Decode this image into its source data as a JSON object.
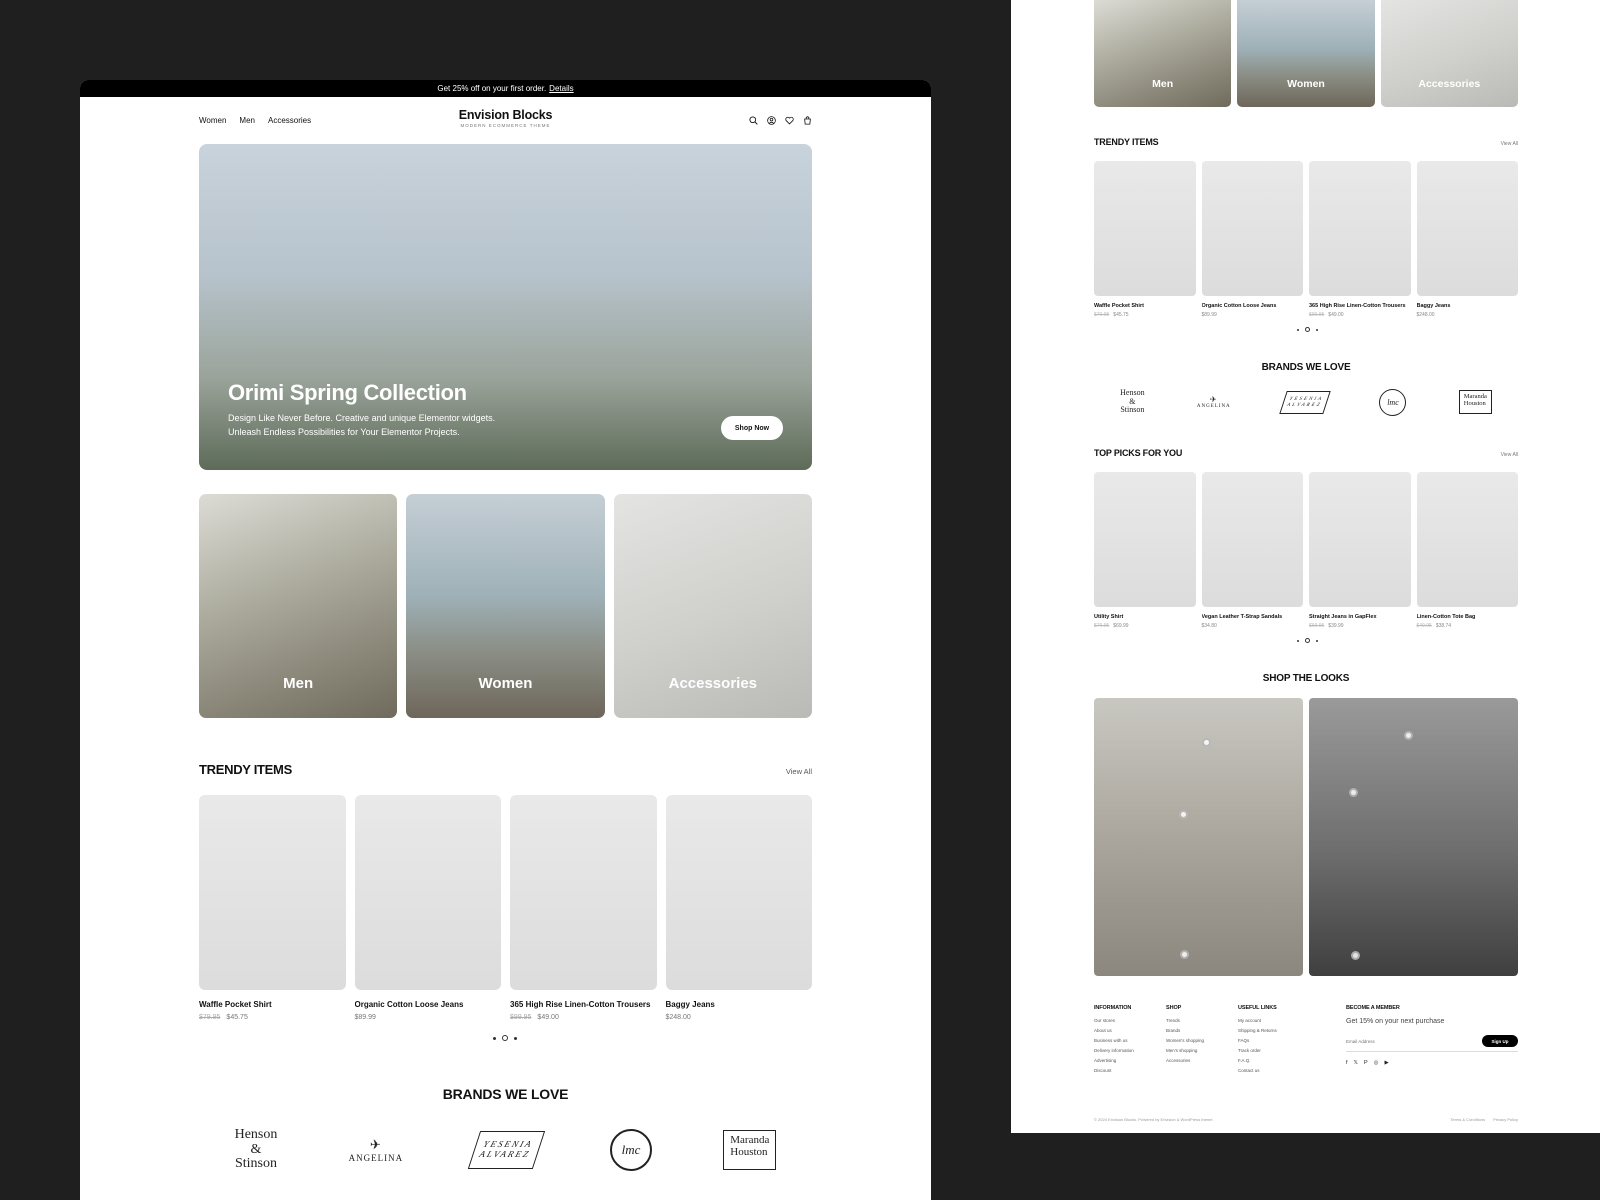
{
  "promo": {
    "text": "Get 25% off on your first order.",
    "link": "Details"
  },
  "header": {
    "nav": [
      "Women",
      "Men",
      "Accessories"
    ],
    "brand_name": "Envision Blocks",
    "brand_tagline": "MODERN ECOMMERCE THEME",
    "icons": [
      "search-icon",
      "account-icon",
      "wishlist-icon",
      "cart-icon"
    ]
  },
  "hero": {
    "title": "Orimi Spring Collection",
    "subtitle_line1": "Design Like Never Before. Creative and unique Elementor widgets.",
    "subtitle_line2": "Unleash Endless Possibilities for Your Elementor Projects.",
    "cta": "Shop Now"
  },
  "categories": [
    "Men",
    "Women",
    "Accessories"
  ],
  "trendy": {
    "title": "TRENDY ITEMS",
    "view_all": "View All",
    "products": [
      {
        "name": "Waffle Pocket Shirt",
        "old_price": "$79.95",
        "price": "$45.75"
      },
      {
        "name": "Organic Cotton Loose Jeans",
        "old_price": "",
        "price": "$89.99"
      },
      {
        "name": "365 High Rise Linen-Cotton Trousers",
        "old_price": "$99.95",
        "price": "$49.00"
      },
      {
        "name": "Baggy Jeans",
        "old_price": "",
        "price": "$248.00"
      }
    ]
  },
  "brands": {
    "title": "BRANDS WE LOVE",
    "logos": {
      "henson_1": "Henson",
      "henson_2": "&",
      "henson_3": "Stinson",
      "angelina": "ANGELINA",
      "yesenia_1": "YESENIA",
      "yesenia_2": "ALVAREZ",
      "lmc": "lmc",
      "maranda_1": "Maranda",
      "maranda_2": "Houston"
    }
  },
  "top_picks": {
    "title": "TOP PICKS FOR YOU",
    "view_all": "View All",
    "products": [
      {
        "name": "Utility Shirt",
        "old_price": "$79.95",
        "price": "$69.99"
      },
      {
        "name": "Vegan Leather T-Strap Sandals",
        "old_price": "",
        "price": "$34.80"
      },
      {
        "name": "Straight Jeans in GapFlex",
        "old_price": "$69.95",
        "price": "$39.99"
      },
      {
        "name": "Linen-Cotton Tote Bag",
        "old_price": "$49.95",
        "price": "$38.74"
      }
    ]
  },
  "shop_the_looks": {
    "title": "SHOP THE LOOKS"
  },
  "footer": {
    "columns": [
      {
        "title": "INFORMATION",
        "links": [
          "Our stores",
          "About us",
          "Business with us",
          "Delivery information",
          "Advertising",
          "Discount"
        ]
      },
      {
        "title": "SHOP",
        "links": [
          "Trends",
          "Brands",
          "Women's shopping",
          "Men's shopping",
          "Accessories"
        ]
      },
      {
        "title": "USEFUL LINKS",
        "links": [
          "My account",
          "Shipping & Returns",
          "FAQs",
          "Track order",
          "F.A.Q.",
          "Contact us"
        ]
      }
    ],
    "member": {
      "title": "BECOME A MEMBER",
      "subtitle": "Get 15% on your next purchase",
      "placeholder": "Email Address",
      "button": "Sign Up",
      "social": [
        "f",
        "𝕏",
        "P",
        "◎",
        "▶"
      ]
    },
    "copyright": "© 2024 Envision Blocks. Powered by Envision & WordPress theme.",
    "legal": [
      "Terms & Conditions",
      "Privacy Policy"
    ]
  }
}
